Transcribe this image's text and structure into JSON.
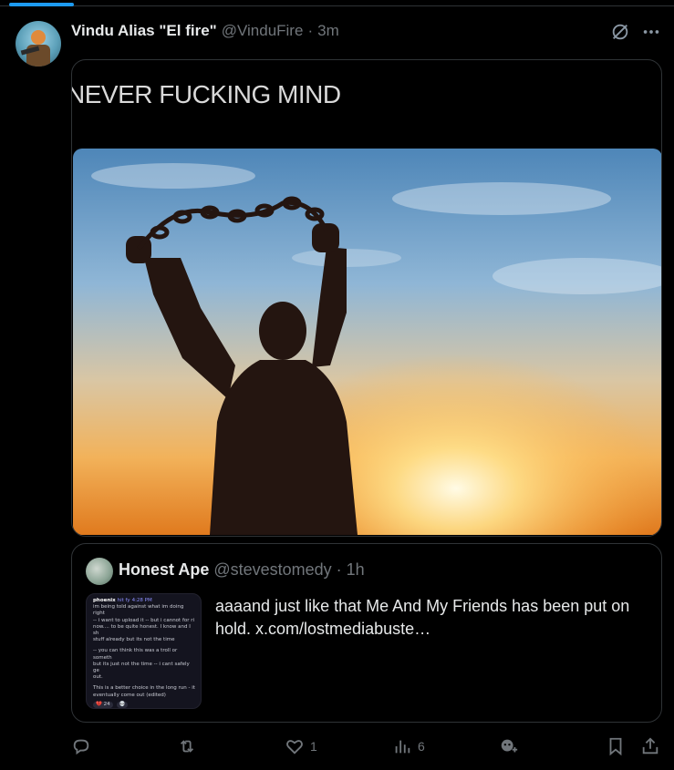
{
  "tweet": {
    "author_name": "Vindu Alias \"El fire\"",
    "author_handle": "@VinduFire",
    "separator": "·",
    "time": "3m",
    "media_caption": "NEVER FUCKING MIND"
  },
  "quote": {
    "author_name": "Honest Ape",
    "author_handle": "@stevestomedy",
    "separator": "·",
    "time": "1h",
    "text": "aaaand just like that Me And My Friends has been put on hold.  x.com/lostmediabuste…",
    "thumb": {
      "user": "phoenix",
      "tag": "hit fy",
      "time": "4:28 PM",
      "lines": [
        "im being told against what im doing right",
        "-- i want to upload it -- but i cannot for ri",
        "now.... to be quite honest. I know and I sh",
        "stuff already but its not the time",
        "",
        "-- you can think this was a troll or someth",
        "but its just not the time -- i cant safely ge",
        "out.",
        "",
        "This is a better choice in the long run - it",
        "eventually come out (edited)"
      ],
      "reactions": [
        "💔 24",
        "💀"
      ]
    }
  },
  "actions": {
    "reply_count": "",
    "repost_count": "",
    "like_count": "1",
    "views_count": "6"
  },
  "colors": {
    "accent": "#1d9bf0",
    "muted": "#71767b",
    "border": "#2f3336",
    "background": "#000000"
  },
  "icons": [
    "grok-icon",
    "more-icon",
    "reply-icon",
    "repost-icon",
    "like-icon",
    "views-icon",
    "grok-analyze-icon",
    "bookmark-icon",
    "share-icon"
  ]
}
